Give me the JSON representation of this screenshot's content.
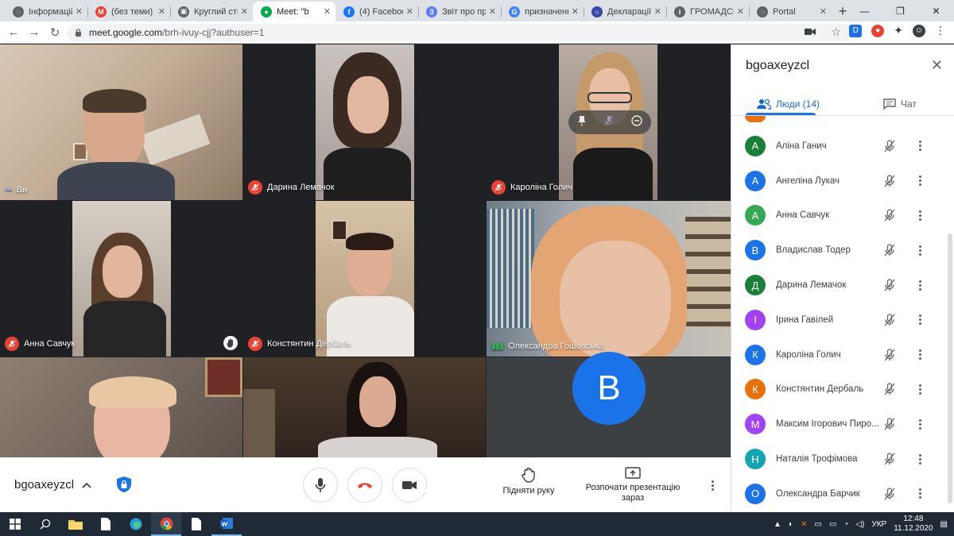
{
  "browser": {
    "tabs": [
      {
        "title": "Інформацій",
        "fav_color": "#5f6368",
        "fav_glyph": "◌"
      },
      {
        "title": "(без теми) -",
        "fav_color": "#ea4335",
        "fav_glyph": "M"
      },
      {
        "title": "Круглий сті",
        "fav_color": "#5f6368",
        "fav_glyph": "▣"
      },
      {
        "title": "Meet: \"b",
        "fav_color": "#00ac47",
        "fav_glyph": "●",
        "active": true
      },
      {
        "title": "(4) Faceboo",
        "fav_color": "#1877f2",
        "fav_glyph": "f"
      },
      {
        "title": "Звіт про пр",
        "fav_color": "#5c7cfa",
        "fav_glyph": "З"
      },
      {
        "title": "призначенн",
        "fav_color": "#4285f4",
        "fav_glyph": "G"
      },
      {
        "title": "Декларації",
        "fav_color": "#3949ab",
        "fav_glyph": "○"
      },
      {
        "title": "ГРОМАДСЬ",
        "fav_color": "#5f6368",
        "fav_glyph": "i"
      },
      {
        "title": "Portal",
        "fav_color": "#5f6368",
        "fav_glyph": "◌"
      }
    ],
    "url_host": "meet.google.com",
    "url_path": "/brh-ivuy-cjj?authuser=1"
  },
  "tiles": [
    {
      "name": "Ви",
      "mic_off": false
    },
    {
      "name": "Дарина Лемачок",
      "mic_off": true
    },
    {
      "name": "Кароліна Голич",
      "mic_off": true
    },
    {
      "name": "Анна Савчук",
      "mic_off": true
    },
    {
      "name": "Констянтин Дербаль",
      "mic_off": true
    },
    {
      "name": "Олександра Гошовська",
      "mic_off": false
    },
    {
      "name": "",
      "mic_off": false
    },
    {
      "name": "",
      "mic_off": false
    },
    {
      "name": "",
      "avatar_letter": "B"
    }
  ],
  "callbar": {
    "meeting_code": "bgoaxeyzcl",
    "raise_hand_label": "Підняти руку",
    "present_label_1": "Розпочати презентацію",
    "present_label_2": "зараз"
  },
  "panel": {
    "title": "bgoaxeyzcl",
    "tab_people": "Люди (14)",
    "tab_chat": "Чат",
    "people": [
      {
        "letter": "А",
        "name": "Аліна Ганич",
        "color": "#188038"
      },
      {
        "letter": "А",
        "name": "Ангеліна Лукач",
        "color": "#1a73e8"
      },
      {
        "letter": "А",
        "name": "Анна Савчук",
        "color": "#34a853"
      },
      {
        "letter": "В",
        "name": "Владислав Тодер",
        "color": "#1a73e8"
      },
      {
        "letter": "Д",
        "name": "Дарина Лемачок",
        "color": "#188038"
      },
      {
        "letter": "І",
        "name": "Ірина Гавілей",
        "color": "#a142f4"
      },
      {
        "letter": "К",
        "name": "Кароліна Голич",
        "color": "#1a73e8"
      },
      {
        "letter": "К",
        "name": "Констянтин Дербаль",
        "color": "#e8710a"
      },
      {
        "letter": "М",
        "name": "Максим Ігорович Пиро...",
        "color": "#a142f4"
      },
      {
        "letter": "Н",
        "name": "Наталія Трофімова",
        "color": "#12a4af"
      },
      {
        "letter": "О",
        "name": "Олександра Барчик",
        "color": "#1a73e8"
      }
    ]
  },
  "taskbar": {
    "language": "УКР",
    "time": "12:48",
    "date": "11.12.2020"
  }
}
